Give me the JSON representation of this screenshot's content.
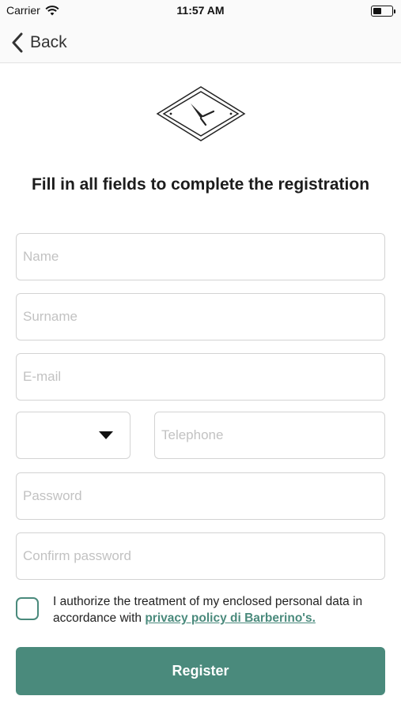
{
  "status_bar": {
    "carrier": "Carrier",
    "time": "11:57 AM"
  },
  "nav": {
    "back_label": "Back"
  },
  "title": "Fill in all fields to complete the registration",
  "form": {
    "name_placeholder": "Name",
    "surname_placeholder": "Surname",
    "email_placeholder": "E-mail",
    "country_code_value": "",
    "telephone_placeholder": "Telephone",
    "password_placeholder": "Password",
    "confirm_password_placeholder": "Confirm password"
  },
  "consent": {
    "text": "I authorize the treatment of my enclosed personal data in accordance with ",
    "link_text": "privacy policy di Barberino's.",
    "checked": false
  },
  "register_label": "Register",
  "colors": {
    "accent": "#4a8a7c",
    "field_border": "#d3d3d3",
    "placeholder": "#c2c2c2"
  },
  "icons": {
    "signal": "wifi-icon",
    "battery": "battery-icon",
    "back": "chevron-left-icon",
    "logo": "razor-logo-icon",
    "dropdown": "caret-down-icon"
  }
}
